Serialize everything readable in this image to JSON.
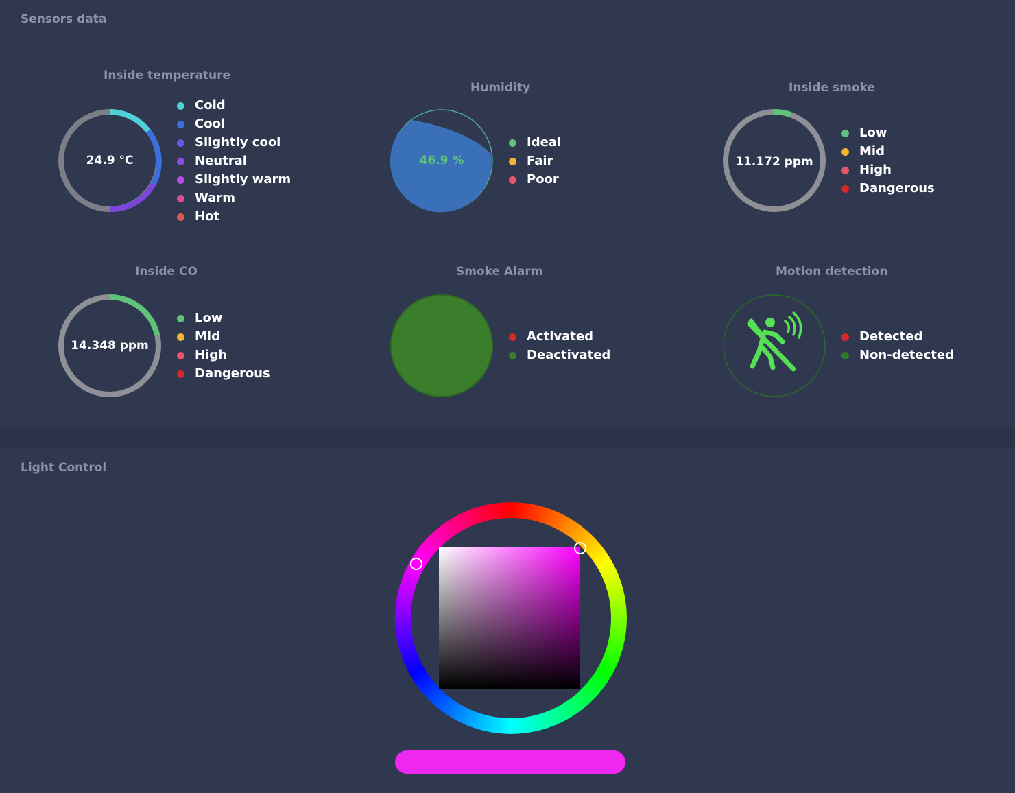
{
  "sensors": {
    "title": "Sensors data",
    "temperature": {
      "title": "Inside temperature",
      "value": "24.9 °C",
      "legend": [
        {
          "label": "Cold",
          "color": "#4fd1d9"
        },
        {
          "label": "Cool",
          "color": "#3b6fe0"
        },
        {
          "label": "Slightly cool",
          "color": "#6a55e6"
        },
        {
          "label": "Neutral",
          "color": "#8a4fe0"
        },
        {
          "label": "Slightly warm",
          "color": "#b24fe0"
        },
        {
          "label": "Warm",
          "color": "#d94f9a"
        },
        {
          "label": "Hot",
          "color": "#d9574f"
        }
      ]
    },
    "humidity": {
      "title": "Humidity",
      "value": "46.9 %",
      "fill_percent": 46.9,
      "legend": [
        {
          "label": "Ideal",
          "color": "#5ec47a"
        },
        {
          "label": "Fair",
          "color": "#f2b531"
        },
        {
          "label": "Poor",
          "color": "#e9566a"
        }
      ]
    },
    "smoke": {
      "title": "Inside smoke",
      "value": "11.172 ppm",
      "legend": [
        {
          "label": "Low",
          "color": "#5ec47a"
        },
        {
          "label": "Mid",
          "color": "#f2b531"
        },
        {
          "label": "High",
          "color": "#e9566a"
        },
        {
          "label": "Dangerous",
          "color": "#d42a2a"
        }
      ]
    },
    "co": {
      "title": "Inside CO",
      "value": "14.348 ppm",
      "legend": [
        {
          "label": "Low",
          "color": "#5ec47a"
        },
        {
          "label": "Mid",
          "color": "#f2b531"
        },
        {
          "label": "High",
          "color": "#e9566a"
        },
        {
          "label": "Dangerous",
          "color": "#d42a2a"
        }
      ]
    },
    "smoke_alarm": {
      "title": "Smoke Alarm",
      "state_color": "#3a7d2a",
      "legend": [
        {
          "label": "Activated",
          "color": "#d42a2a"
        },
        {
          "label": "Deactivated",
          "color": "#3a7d2a"
        }
      ]
    },
    "motion": {
      "title": "Motion detection",
      "icon": "motion-sensor-icon",
      "legend": [
        {
          "label": "Detected",
          "color": "#d42a2a"
        },
        {
          "label": "Non-detected",
          "color": "#2d7a2a"
        }
      ]
    }
  },
  "light": {
    "title": "Light Control",
    "selected_color": "#ee28ee"
  }
}
